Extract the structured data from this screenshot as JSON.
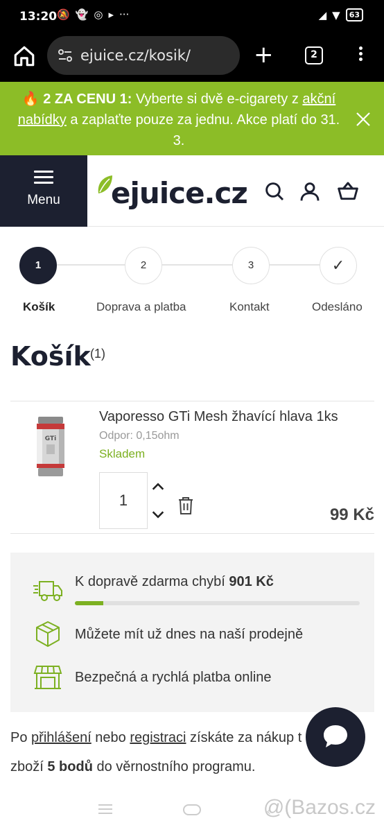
{
  "status_bar": {
    "time": "13:20",
    "battery": "63"
  },
  "browser": {
    "url": "ejuice.cz/kosik/",
    "tab_count": "2"
  },
  "promo": {
    "emoji": "🔥",
    "bold": "2 ZA CENU 1:",
    "text_before": " Vyberte si dvě e-cigarety z ",
    "link": "akční nabídky",
    "text_after": " a zaplaťte pouze za jednu. Akce platí do 31. 3."
  },
  "header": {
    "menu_label": "Menu",
    "logo_text": "ejuice.cz"
  },
  "steps": [
    {
      "number": "1",
      "label": "Košík"
    },
    {
      "number": "2",
      "label": "Doprava a platba"
    },
    {
      "number": "3",
      "label": "Kontakt"
    },
    {
      "number": "✓",
      "label": "Odesláno"
    }
  ],
  "page": {
    "title": "Košík",
    "count": "(1)"
  },
  "cart_item": {
    "name": "Vaporesso GTi Mesh žhavící hlava 1ks",
    "attribute": "Odpor: 0,15ohm",
    "stock": "Skladem",
    "quantity": "1",
    "price": "99 Kč"
  },
  "benefits": {
    "shipping_text": "K dopravě zdarma chybí ",
    "shipping_amount": "901 Kč",
    "shipping_progress": 0.1,
    "store_text": "Můžete mít už dnes na naší prodejně",
    "payment_text": "Bezpečná a rychlá platba online"
  },
  "loyalty": {
    "t1": "Po ",
    "link_login": "přihlášení",
    "t2": " nebo ",
    "link_register": "registraci",
    "t3": " získáte za nákup t",
    "t4": "zboží ",
    "points": "5 bodů",
    "t5": " do věrnostního programu."
  },
  "watermark": "@(Bazos.cz",
  "colors": {
    "brand_dark": "#1c2030",
    "brand_green": "#8cbd27",
    "stock_green": "#7cb021"
  }
}
